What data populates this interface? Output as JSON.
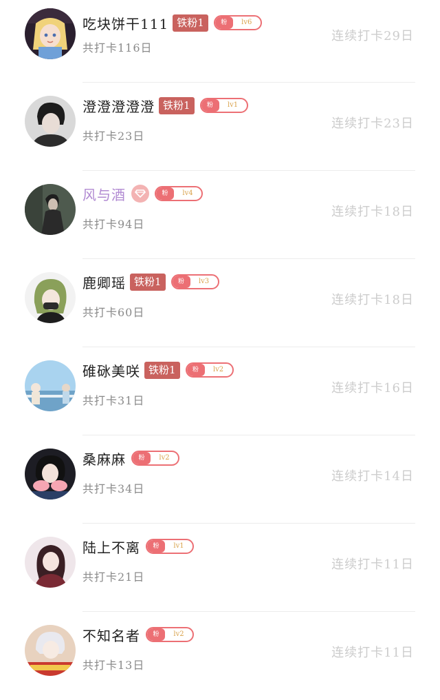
{
  "users": [
    {
      "name": "吃块饼干111",
      "tie_badge": "铁粉1",
      "fan_label": "粉",
      "level": "lv6",
      "total": "共打卡116日",
      "streak": "连续打卡29日"
    },
    {
      "name": "澄澄澄澄澄",
      "tie_badge": "铁粉1",
      "fan_label": "粉",
      "level": "lv1",
      "total": "共打卡23日",
      "streak": "连续打卡23日"
    },
    {
      "name": "风与酒",
      "tie_badge": "",
      "fan_label": "粉",
      "level": "lv4",
      "total": "共打卡94日",
      "streak": "连续打卡18日"
    },
    {
      "name": "鹿卿瑶",
      "tie_badge": "铁粉1",
      "fan_label": "粉",
      "level": "lv3",
      "total": "共打卡60日",
      "streak": "连续打卡18日"
    },
    {
      "name": "碓砯美咲",
      "tie_badge": "铁粉1",
      "fan_label": "粉",
      "level": "lv2",
      "total": "共打卡31日",
      "streak": "连续打卡16日"
    },
    {
      "name": "桑麻麻",
      "tie_badge": "",
      "fan_label": "粉",
      "level": "lv2",
      "total": "共打卡34日",
      "streak": "连续打卡14日"
    },
    {
      "name": "陆上不离",
      "tie_badge": "",
      "fan_label": "粉",
      "level": "lv1",
      "total": "共打卡21日",
      "streak": "连续打卡11日"
    },
    {
      "name": "不知名者",
      "tie_badge": "",
      "fan_label": "粉",
      "level": "lv2",
      "total": "共打卡13日",
      "streak": "连续打卡11日"
    }
  ],
  "colors": {
    "tie_badge_bg": "#c9625e",
    "level_badge": "#ec6f74",
    "level_text": "#d9a24a",
    "vip_name": "#b18ad2",
    "streak_text": "#cccccc",
    "total_text": "#8a8a8a"
  },
  "icons": {
    "vip": "diamond-icon"
  }
}
